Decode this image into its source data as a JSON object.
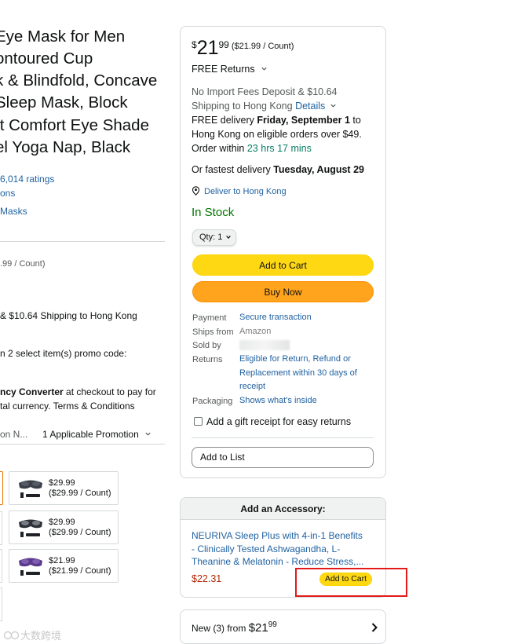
{
  "product": {
    "title_lines": [
      "Eye Mask for Men",
      "ontoured Cup",
      "k & Blindfold, Concave",
      " Sleep Mask, Block",
      "ft Comfort Eye Shade",
      "el Yoga Nap, Black"
    ],
    "ratings_text": "6,014 ratings",
    "answers_text": "ons",
    "category_link": "Masks",
    "left_unit_price": ".99 / Count)",
    "left_shipping": "& $10.64 Shipping to Hong Kong",
    "left_promo": "n 2 select item(s) promo code:",
    "left_currency_bold": "ncy Converter",
    "left_currency_rest": " at checkout to pay for",
    "left_currency_line2": "tal currency. Terms & Conditions",
    "left_promo_cut": "on N...",
    "left_promo_link": "1 Applicable Promotion",
    "variants": [
      {
        "price": "$29.99",
        "unit": "($29.99 / Count)",
        "color": "#3a3f48"
      },
      {
        "price": "$29.99",
        "unit": "($29.99 / Count)",
        "color": "#2e3137"
      },
      {
        "price": "$21.99",
        "unit": "($21.99 / Count)",
        "color": "#5b3a8c"
      }
    ]
  },
  "buybox": {
    "price_symbol": "$",
    "price_whole": "21",
    "price_fraction": "99",
    "price_unit": "($21.99 / Count)",
    "free_returns": "FREE Returns",
    "import_fees": "No Import Fees Deposit & $10.64",
    "shipping_to": "Shipping to Hong Kong",
    "details_link": "Details",
    "delivery_prefix": "FREE delivery ",
    "delivery_date": "Friday, September 1",
    "delivery_suffix": " to",
    "delivery_line2": "Hong Kong on eligible orders over $49.",
    "order_within_prefix": "Order within ",
    "order_within_time": "23 hrs 17 mins",
    "fastest_prefix": "Or fastest delivery ",
    "fastest_date": "Tuesday, August 29",
    "deliver_to": "Deliver to Hong Kong",
    "stock": "In Stock",
    "qty_label": "Qty: 1",
    "add_to_cart": "Add to Cart",
    "buy_now": "Buy Now",
    "payment_label": "Payment",
    "payment_value": "Secure transaction",
    "ships_from_label": "Ships from",
    "ships_from_value": "Amazon",
    "sold_by_label": "Sold by",
    "returns_label": "Returns",
    "returns_lines": [
      "Eligible for Return, Refund or",
      "Replacement within 30 days of",
      "receipt"
    ],
    "packaging_label": "Packaging",
    "packaging_value": "Shows what's inside",
    "gift_receipt": "Add a gift receipt for easy returns",
    "add_to_list": "Add to List"
  },
  "accessory": {
    "heading": "Add an Accessory:",
    "name_lines": [
      "NEURIVA Sleep Plus with 4-in-1 Benefits",
      "- Clinically Tested Ashwagandha, L-",
      "Theanine & Melatonin - Reduce Stress,..."
    ],
    "price": "$22.31",
    "add_to_cart": "Add to Cart"
  },
  "new_offers": {
    "prefix": "New (3) from ",
    "price_whole": "$21",
    "price_fraction": "99"
  },
  "watermark": "大数跨境",
  "colors": {
    "link": "#2162a1",
    "green": "#067d62",
    "in_stock": "#007600",
    "cart_yellow": "#ffd814",
    "buy_orange": "#ffa41c",
    "price_red": "#b12704",
    "highlight_red": "#e21a1a"
  }
}
